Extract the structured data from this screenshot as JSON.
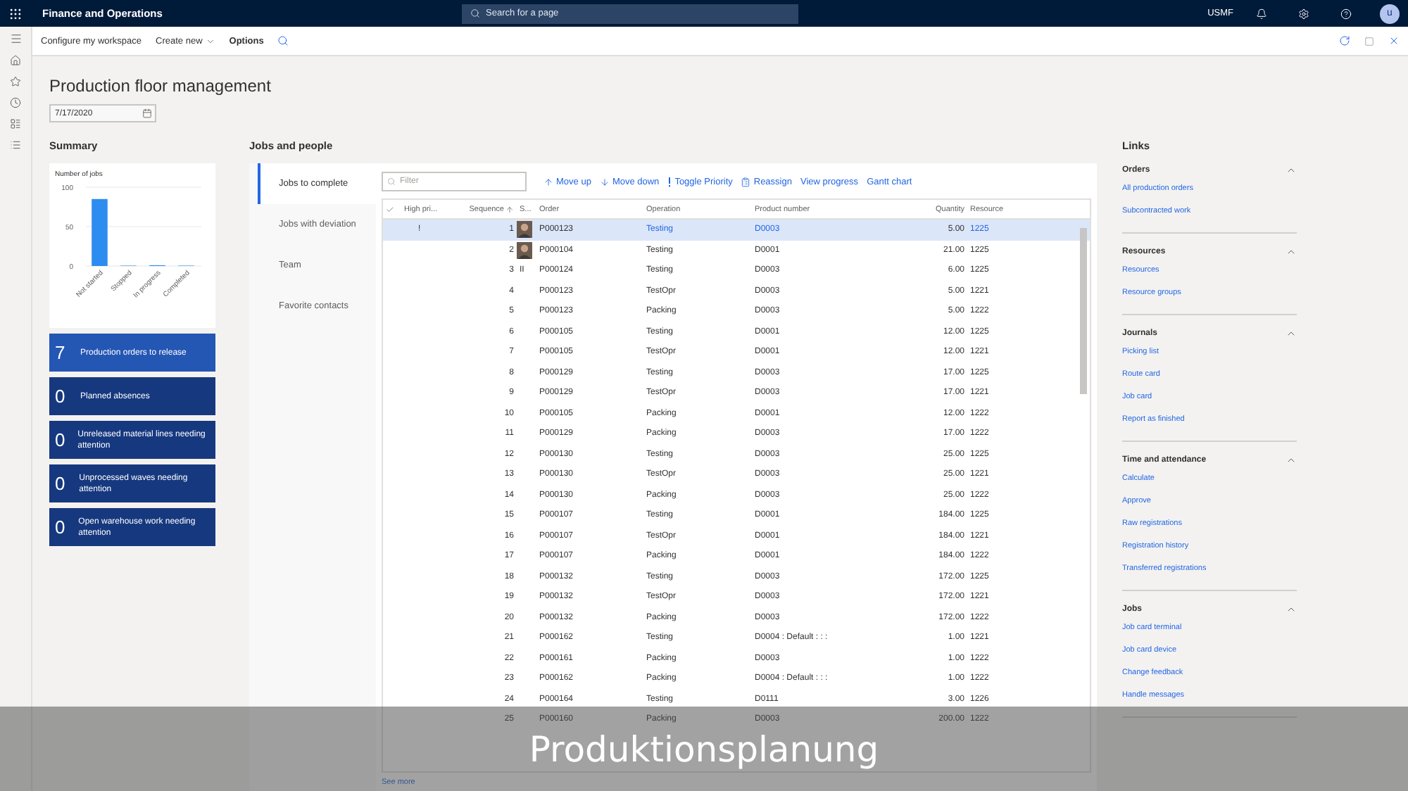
{
  "app": {
    "title": "Finance and Operations",
    "search_placeholder": "Search for a page",
    "company": "USMF",
    "avatar_initial": "u"
  },
  "command_bar": {
    "items": [
      {
        "label": "Configure my workspace",
        "kind": "plain"
      },
      {
        "label": "Create new",
        "kind": "dropdown"
      },
      {
        "label": "Options",
        "kind": "bold"
      }
    ]
  },
  "page": {
    "title": "Production floor management",
    "date": "7/17/2020"
  },
  "summary": {
    "heading": "Summary",
    "chart_data": {
      "type": "bar",
      "title": "Number of jobs",
      "categories": [
        "Not started",
        "Stopped",
        "In progress",
        "Completed"
      ],
      "values": [
        85,
        0,
        1,
        0
      ],
      "ylim": [
        0,
        100
      ],
      "yticks": [
        0,
        50,
        100
      ]
    },
    "tiles": [
      {
        "count": "7",
        "label": "Production orders to release",
        "color": "#2456b4"
      },
      {
        "count": "0",
        "label": "Planned absences",
        "color": "#16387f"
      },
      {
        "count": "0",
        "label": "Unreleased material lines needing attention",
        "color": "#16387f"
      },
      {
        "count": "0",
        "label": "Unprocessed waves needing attention",
        "color": "#16387f"
      },
      {
        "count": "0",
        "label": "Open warehouse work needing attention",
        "color": "#16387f"
      }
    ]
  },
  "jobs": {
    "heading": "Jobs and people",
    "tabs": [
      {
        "label": "Jobs to complete",
        "selected": true
      },
      {
        "label": "Jobs with deviation",
        "selected": false
      },
      {
        "label": "Team",
        "selected": false
      },
      {
        "label": "Favorite contacts",
        "selected": false
      }
    ],
    "filter_placeholder": "Filter",
    "actions": [
      {
        "label": "Move up",
        "kind": "up"
      },
      {
        "label": "Move down",
        "kind": "down"
      },
      {
        "label": "Toggle Priority",
        "kind": "priority"
      },
      {
        "label": "Reassign",
        "kind": "reassign"
      },
      {
        "label": "View progress",
        "kind": "plain"
      },
      {
        "label": "Gantt chart",
        "kind": "plain"
      }
    ],
    "columns": [
      "High pri...",
      "Sequence",
      "S...",
      "Order",
      "Operation",
      "Product number",
      "Quantity",
      "Resource"
    ],
    "rows": [
      {
        "selected": true,
        "high_priority": "!",
        "sequence": "1",
        "avatar": true,
        "order": "P000123",
        "operation": "Testing",
        "product": "D0003",
        "quantity": "5.00",
        "resource": "1225"
      },
      {
        "selected": false,
        "sequence": "2",
        "avatar": true,
        "order": "P000104",
        "operation": "Testing",
        "product": "D0001",
        "quantity": "21.00",
        "resource": "1225"
      },
      {
        "selected": false,
        "sequence": "3",
        "avatar": false,
        "status": "II",
        "order": "P000124",
        "operation": "Testing",
        "product": "D0003",
        "quantity": "6.00",
        "resource": "1225"
      },
      {
        "selected": false,
        "sequence": "4",
        "avatar": false,
        "order": "P000123",
        "operation": "TestOpr",
        "product": "D0003",
        "quantity": "5.00",
        "resource": "1221"
      },
      {
        "selected": false,
        "sequence": "5",
        "avatar": false,
        "order": "P000123",
        "operation": "Packing",
        "product": "D0003",
        "quantity": "5.00",
        "resource": "1222"
      },
      {
        "selected": false,
        "sequence": "6",
        "avatar": false,
        "order": "P000105",
        "operation": "Testing",
        "product": "D0001",
        "quantity": "12.00",
        "resource": "1225"
      },
      {
        "selected": false,
        "sequence": "7",
        "avatar": false,
        "order": "P000105",
        "operation": "TestOpr",
        "product": "D0001",
        "quantity": "12.00",
        "resource": "1221"
      },
      {
        "selected": false,
        "sequence": "8",
        "avatar": false,
        "order": "P000129",
        "operation": "Testing",
        "product": "D0003",
        "quantity": "17.00",
        "resource": "1225"
      },
      {
        "selected": false,
        "sequence": "9",
        "avatar": false,
        "order": "P000129",
        "operation": "TestOpr",
        "product": "D0003",
        "quantity": "17.00",
        "resource": "1221"
      },
      {
        "selected": false,
        "sequence": "10",
        "avatar": false,
        "order": "P000105",
        "operation": "Packing",
        "product": "D0001",
        "quantity": "12.00",
        "resource": "1222"
      },
      {
        "selected": false,
        "sequence": "11",
        "avatar": false,
        "order": "P000129",
        "operation": "Packing",
        "product": "D0003",
        "quantity": "17.00",
        "resource": "1222"
      },
      {
        "selected": false,
        "sequence": "12",
        "avatar": false,
        "order": "P000130",
        "operation": "Testing",
        "product": "D0003",
        "quantity": "25.00",
        "resource": "1225"
      },
      {
        "selected": false,
        "sequence": "13",
        "avatar": false,
        "order": "P000130",
        "operation": "TestOpr",
        "product": "D0003",
        "quantity": "25.00",
        "resource": "1221"
      },
      {
        "selected": false,
        "sequence": "14",
        "avatar": false,
        "order": "P000130",
        "operation": "Packing",
        "product": "D0003",
        "quantity": "25.00",
        "resource": "1222"
      },
      {
        "selected": false,
        "sequence": "15",
        "avatar": false,
        "order": "P000107",
        "operation": "Testing",
        "product": "D0001",
        "quantity": "184.00",
        "resource": "1225"
      },
      {
        "selected": false,
        "sequence": "16",
        "avatar": false,
        "order": "P000107",
        "operation": "TestOpr",
        "product": "D0001",
        "quantity": "184.00",
        "resource": "1221"
      },
      {
        "selected": false,
        "sequence": "17",
        "avatar": false,
        "order": "P000107",
        "operation": "Packing",
        "product": "D0001",
        "quantity": "184.00",
        "resource": "1222"
      },
      {
        "selected": false,
        "sequence": "18",
        "avatar": false,
        "order": "P000132",
        "operation": "Testing",
        "product": "D0003",
        "quantity": "172.00",
        "resource": "1225"
      },
      {
        "selected": false,
        "sequence": "19",
        "avatar": false,
        "order": "P000132",
        "operation": "TestOpr",
        "product": "D0003",
        "quantity": "172.00",
        "resource": "1221"
      },
      {
        "selected": false,
        "sequence": "20",
        "avatar": false,
        "order": "P000132",
        "operation": "Packing",
        "product": "D0003",
        "quantity": "172.00",
        "resource": "1222"
      },
      {
        "selected": false,
        "sequence": "21",
        "avatar": false,
        "order": "P000162",
        "operation": "Testing",
        "product": "D0004 : Default : : :",
        "quantity": "1.00",
        "resource": "1221"
      },
      {
        "selected": false,
        "sequence": "22",
        "avatar": false,
        "order": "P000161",
        "operation": "Packing",
        "product": "D0003",
        "quantity": "1.00",
        "resource": "1222"
      },
      {
        "selected": false,
        "sequence": "23",
        "avatar": false,
        "order": "P000162",
        "operation": "Packing",
        "product": "D0004 : Default : : :",
        "quantity": "1.00",
        "resource": "1222"
      },
      {
        "selected": false,
        "sequence": "24",
        "avatar": false,
        "order": "P000164",
        "operation": "Testing",
        "product": "D0111",
        "quantity": "3.00",
        "resource": "1226"
      },
      {
        "selected": false,
        "sequence": "25",
        "avatar": false,
        "order": "P000160",
        "operation": "Packing",
        "product": "D0003",
        "quantity": "200.00",
        "resource": "1222"
      }
    ],
    "see_more": "See more"
  },
  "links": {
    "heading": "Links",
    "groups": [
      {
        "title": "Orders",
        "expanded": true,
        "items": [
          "All production orders",
          "Subcontracted work"
        ]
      },
      {
        "title": "Resources",
        "expanded": true,
        "items": [
          "Resources",
          "Resource groups"
        ]
      },
      {
        "title": "Journals",
        "expanded": true,
        "items": [
          "Picking list",
          "Route card",
          "Job card",
          "Report as finished"
        ]
      },
      {
        "title": "Time and attendance",
        "expanded": true,
        "items": [
          "Calculate",
          "Approve",
          "Raw registrations",
          "Registration history",
          "Transferred registrations"
        ]
      },
      {
        "title": "Jobs",
        "expanded": true,
        "items": [
          "Job card terminal",
          "Job card device",
          "Change feedback",
          "Handle messages"
        ]
      }
    ]
  },
  "caption": "Produktionsplanung"
}
